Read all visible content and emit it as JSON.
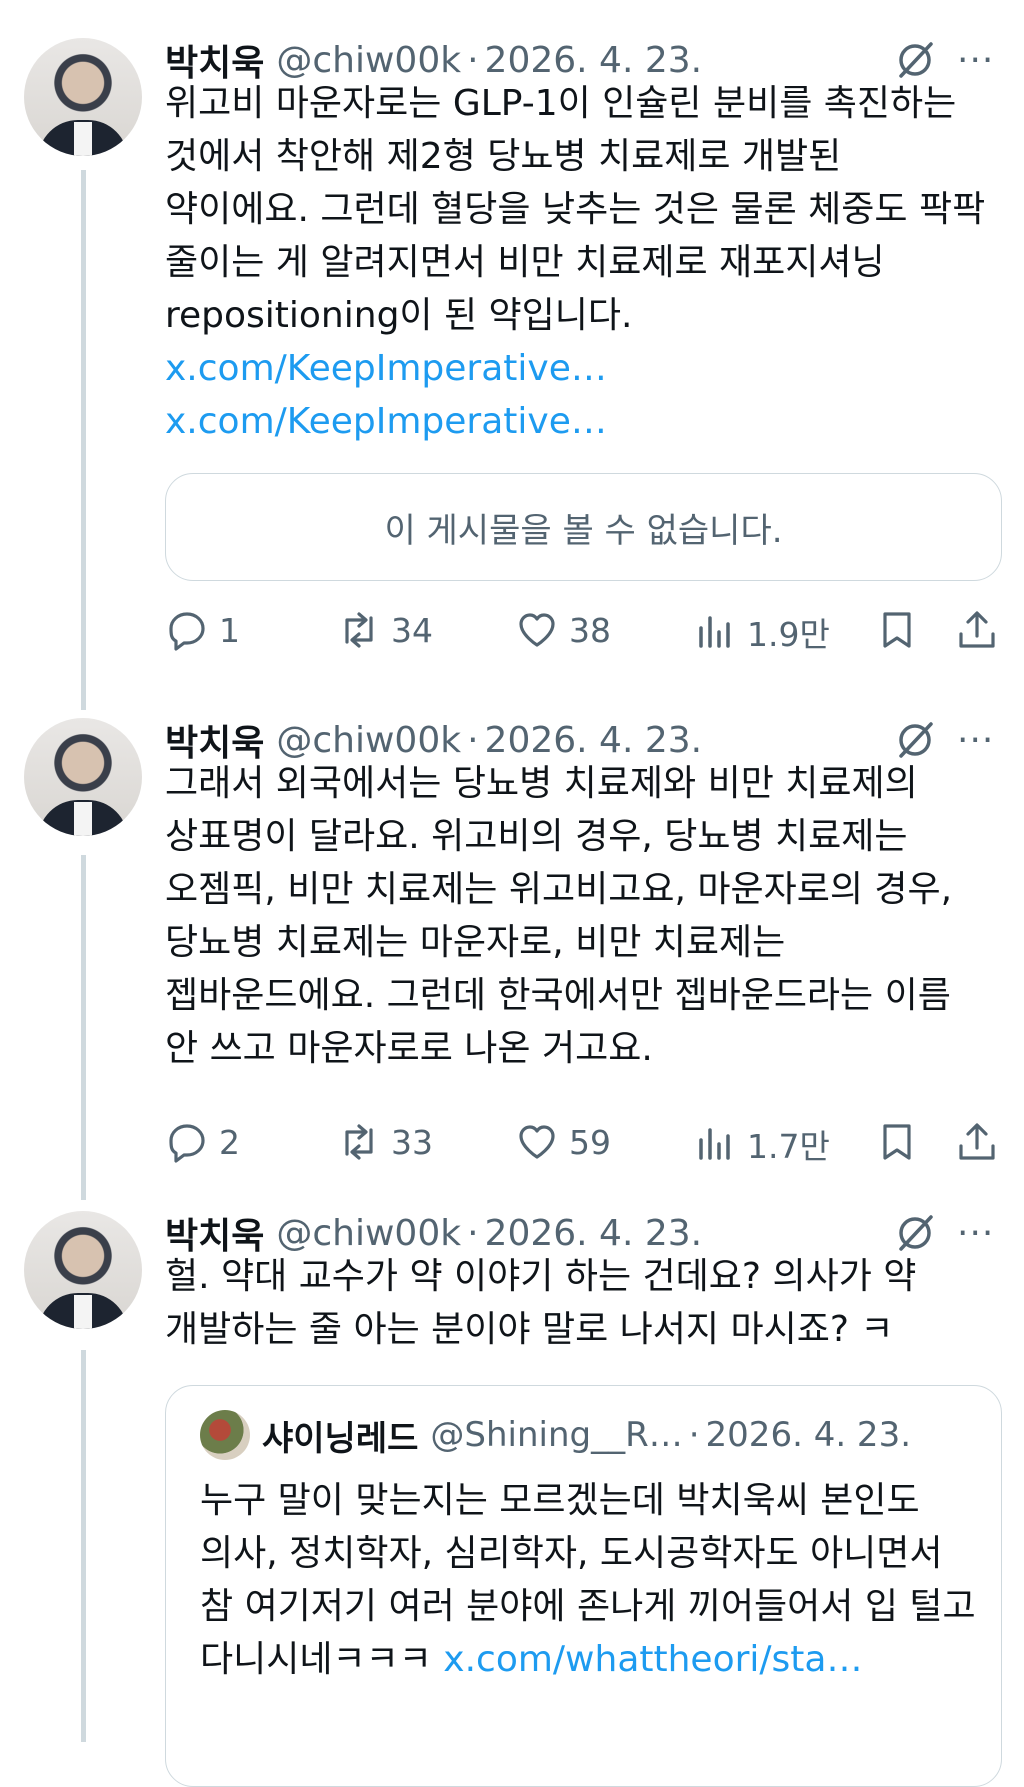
{
  "tweets": [
    {
      "author": "박치욱",
      "handle": "@chiw00k",
      "separator": "·",
      "date": "2026. 4. 23.",
      "text": "위고비 마운자로는 GLP-1이 인슐린 분비를 촉진하는 것에서 착안해 제2형 당뇨병 치료제로 개발된 약이에요. 그런데 혈당을 낮추는 것은 물론 체중도 팍팍 줄이는 게 알려지면서 비만 치료제로 재포지셔닝 repositioning이 된 약입니다.",
      "links": "x.com/KeepImperative… x.com/KeepImperative…",
      "card_text": "이 게시물을 볼 수 없습니다.",
      "stats": {
        "replies": "1",
        "retweets": "34",
        "likes": "38",
        "views": "1.9만"
      }
    },
    {
      "author": "박치욱",
      "handle": "@chiw00k",
      "separator": "·",
      "date": "2026. 4. 23.",
      "text": "그래서 외국에서는 당뇨병 치료제와 비만 치료제의 상표명이 달라요. 위고비의 경우, 당뇨병 치료제는 오젬픽, 비만 치료제는 위고비고요, 마운자로의 경우, 당뇨병 치료제는 마운자로, 비만 치료제는 젭바운드에요. 그런데 한국에서만 젭바운드라는 이름 안 쓰고 마운자로로 나온 거고요.",
      "stats": {
        "replies": "2",
        "retweets": "33",
        "likes": "59",
        "views": "1.7만"
      }
    },
    {
      "author": "박치욱",
      "handle": "@chiw00k",
      "separator": "·",
      "date": "2026. 4. 23.",
      "text": "헐. 약대 교수가 약 이야기 하는 건데요? 의사가 약 개발하는 줄 아는 분이야 말로 나서지 마시죠? ㅋ",
      "quote": {
        "author": "샤이닝레드",
        "handle": "@Shining__R…",
        "separator": "·",
        "date": "2026. 4. 23.",
        "text": "누구 말이 맞는지는 모르겠는데 박치욱씨 본인도 의사, 정치학자, 심리학자, 도시공학자도 아니면서 참 여기저기 여러 분야에 존나게 끼어들어서 입 털고 다니시네ㅋㅋㅋ ",
        "link": "x.com/whattheori/sta…"
      }
    }
  ],
  "icons": {
    "more": "more-horizontal-icon",
    "grok": "grok-icon",
    "reply": "reply-icon",
    "retweet": "retweet-icon",
    "like": "heart-icon",
    "views": "views-icon",
    "bookmark": "bookmark-icon",
    "share": "share-icon"
  },
  "colors": {
    "link": "#1d9bf0",
    "muted": "#536471",
    "text": "#0f1419",
    "border": "#cfd9de"
  }
}
